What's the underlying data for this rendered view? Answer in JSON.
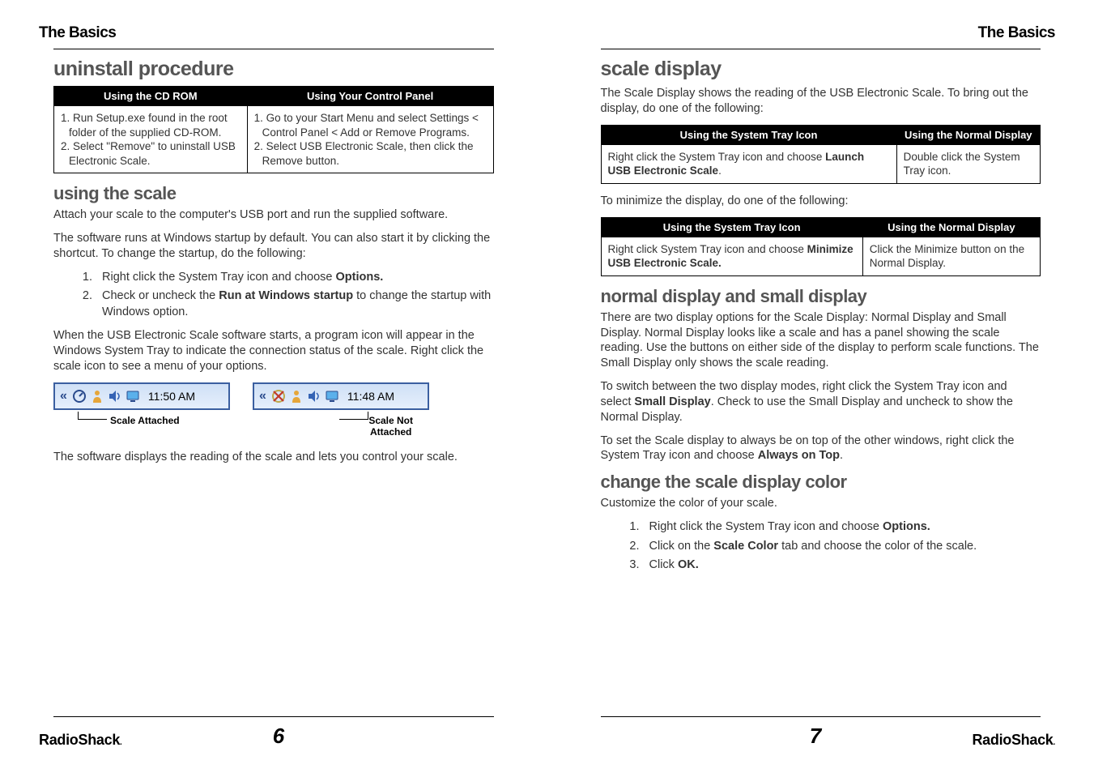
{
  "left": {
    "header": "The Basics",
    "brand": "RadioShack",
    "page_num": "6",
    "s1": {
      "title": "uninstall procedure",
      "th1": "Using the CD ROM",
      "th2": "Using Your Control Panel",
      "td1a": "1. Run Setup.exe found in the root folder of the supplied CD-ROM.",
      "td1b": "2. Select \"Remove\" to uninstall USB Electronic Scale.",
      "td2a": "1. Go to your Start Menu and select Settings < Control Panel < Add or Remove Programs.",
      "td2b": "2. Select USB Electronic Scale, then click the Remove button."
    },
    "s2": {
      "title": "using the scale",
      "p1": "Attach your scale to the computer's USB port and run the supplied software.",
      "p2": "The software runs at Windows startup by default. You can also start it by clicking the shortcut. To change the startup, do the following:",
      "li1a": "Right click the System Tray icon and choose ",
      "li1b": "Options.",
      "li2a": "Check or uncheck the ",
      "li2b": "Run at Windows startup",
      "li2c": " to change the startup with Windows option.",
      "p3": "When the USB Electronic Scale software starts, a program icon will appear in the Windows System Tray to indicate the connection status of the scale. Right click the scale icon to see a menu of your options.",
      "tray1_time": "11:50 AM",
      "tray2_time": "11:48 AM",
      "cap1": "Scale Attached",
      "cap2a": "Scale Not",
      "cap2b": "Attached",
      "p4": "The software displays the reading of the scale and lets you control your scale."
    }
  },
  "right": {
    "header": "The Basics",
    "brand": "RadioShack",
    "page_num": "7",
    "s1": {
      "title": "scale display",
      "p1": "The Scale Display shows the reading of the USB Electronic Scale. To bring out the display, do one of the following:",
      "th1": "Using the System Tray Icon",
      "th2": "Using the Normal Display",
      "td1a": "Right click the System Tray icon and choose ",
      "td1b": "Launch USB Electronic Scale",
      "td1c": ".",
      "td2": "Double click the System Tray icon.",
      "p2": "To minimize the display, do one of the following:",
      "t2th1": "Using the System Tray Icon",
      "t2th2": "Using the Normal Display",
      "t2td1a": "Right click System Tray icon and choose ",
      "t2td1b": "Minimize USB Electronic Scale.",
      "t2td2": "Click the Minimize button on the Normal Display."
    },
    "s2": {
      "title": "normal display and small display",
      "p1": "There are two display options for the Scale Display: Normal Display and Small Display. Normal Display looks like a scale and has a panel showing the scale reading. Use the buttons on either side of the display to perform scale functions. The Small Display only shows the scale reading.",
      "p2a": "To switch between the two display modes, right click the System Tray icon and select ",
      "p2b": "Small Display",
      "p2c": ". Check to use the Small Display and uncheck to show the Normal Display.",
      "p3a": "To set the Scale display to always be on top of the other windows, right click the System Tray icon and choose ",
      "p3b": "Always on Top",
      "p3c": "."
    },
    "s3": {
      "title": "change the scale display color",
      "p1": "Customize the color of your scale.",
      "li1a": "Right click the System Tray icon and choose ",
      "li1b": "Options.",
      "li2a": "Click on the ",
      "li2b": "Scale Color",
      "li2c": " tab and choose the color of the scale.",
      "li3a": "Click ",
      "li3b": "OK."
    }
  }
}
